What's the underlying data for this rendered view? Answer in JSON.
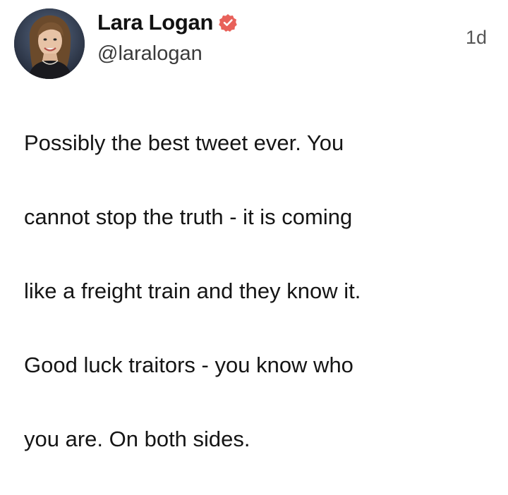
{
  "tweet": {
    "author": {
      "display_name": "Lara Logan",
      "handle": "@laralogan",
      "verified": true,
      "verified_badge_icon": "verified-badge-icon",
      "avatar_icon": "profile-avatar"
    },
    "timestamp": "1d",
    "body_lines": [
      "Possibly the best tweet ever. You",
      "cannot stop the truth - it is coming",
      "like a freight train and they know it.",
      "Good luck traitors - you know who",
      "you are. On both sides."
    ]
  },
  "colors": {
    "badge": "#e8615a",
    "text": "#111111",
    "handle": "#3a3a3a"
  }
}
